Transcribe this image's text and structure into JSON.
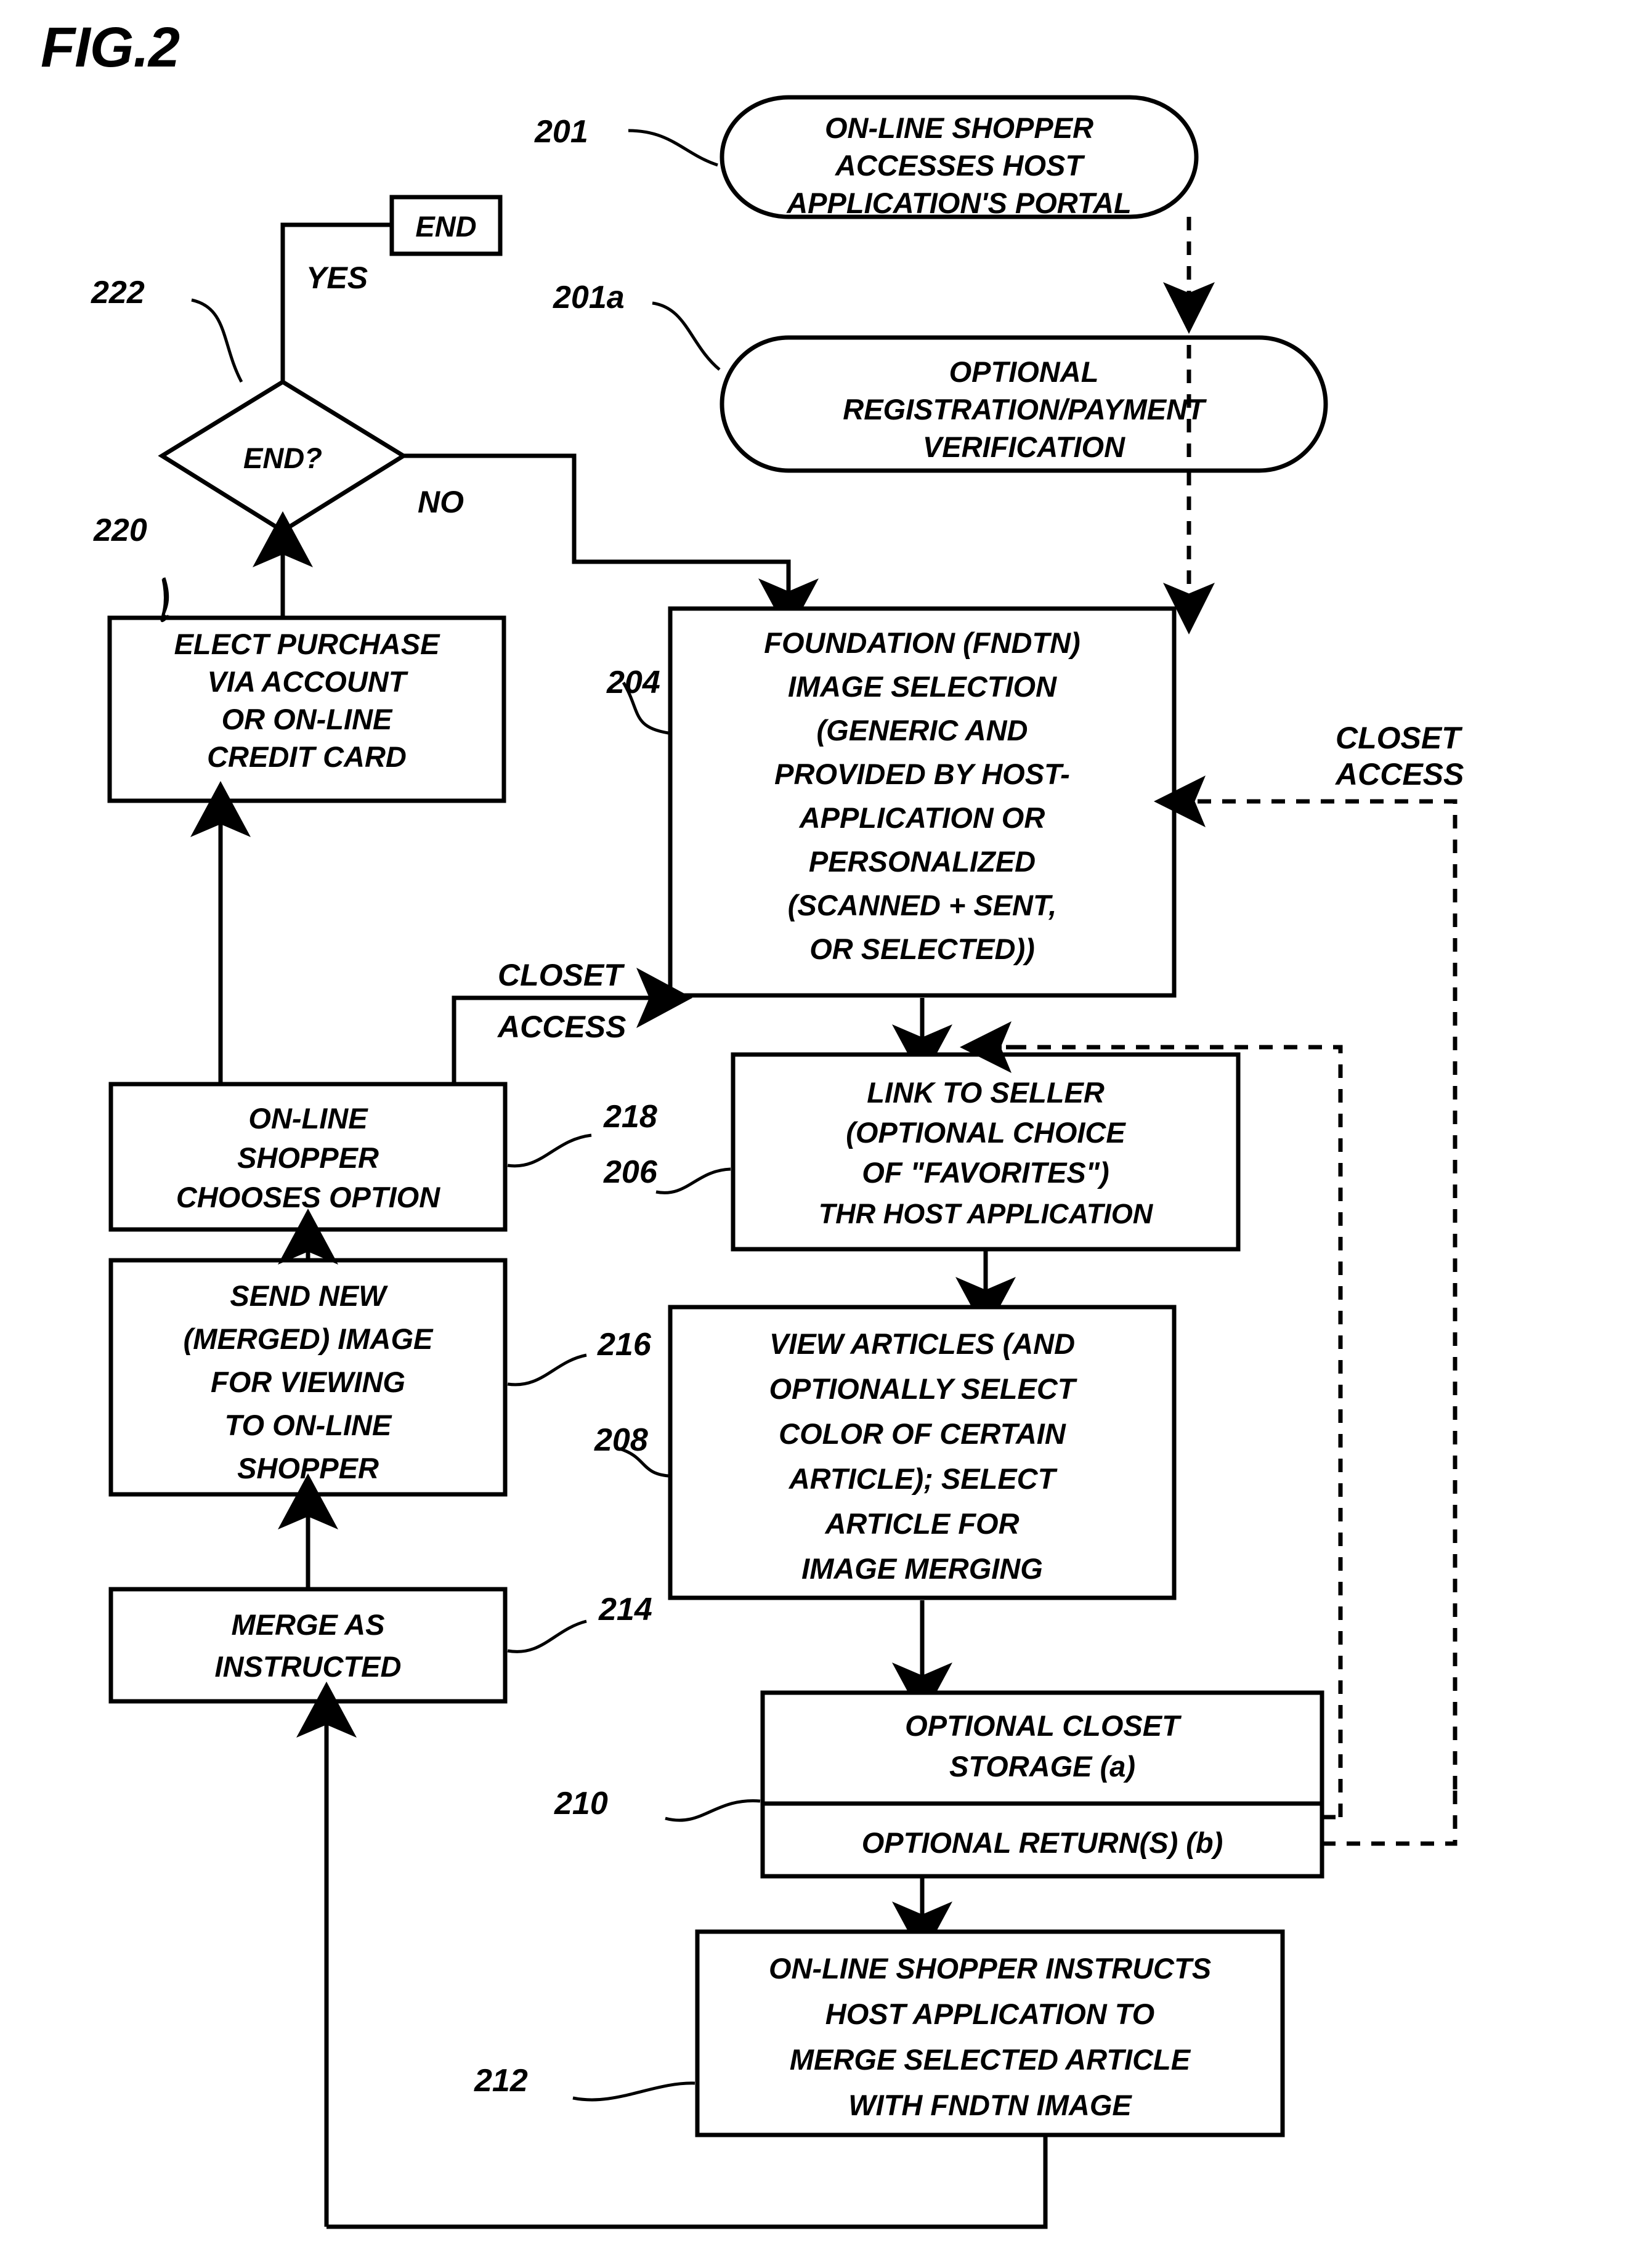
{
  "figure": {
    "title": "FIG.2",
    "domain_note": "patent flowchart"
  },
  "nodes": [
    {
      "id": "201",
      "ref": "201",
      "shape": "stadium",
      "lines": [
        "ON-LINE SHOPPER",
        "ACCESSES HOST",
        "APPLICATION'S PORTAL"
      ]
    },
    {
      "id": "201a",
      "ref": "201a",
      "shape": "stadium",
      "lines": [
        "OPTIONAL",
        "REGISTRATION/PAYMENT",
        "VERIFICATION"
      ]
    },
    {
      "id": "end_terminal",
      "ref": "",
      "shape": "rect",
      "lines": [
        "END"
      ]
    },
    {
      "id": "222",
      "ref": "222",
      "shape": "diamond",
      "lines": [
        "END?"
      ]
    },
    {
      "id": "220",
      "ref": "220",
      "shape": "rect",
      "lines": [
        "ELECT PURCHASE",
        "VIA ACCOUNT",
        "OR ON-LINE",
        "CREDIT CARD"
      ]
    },
    {
      "id": "204",
      "ref": "204",
      "shape": "rect",
      "lines": [
        "FOUNDATION (FNDTN)",
        "IMAGE SELECTION",
        "(GENERIC AND",
        "PROVIDED BY HOST-",
        "APPLICATION OR",
        "PERSONALIZED",
        "(SCANNED + SENT,",
        "OR SELECTED))"
      ]
    },
    {
      "id": "218",
      "ref": "218",
      "shape": "rect",
      "lines": [
        "ON-LINE",
        "SHOPPER",
        "CHOOSES OPTION"
      ]
    },
    {
      "id": "206",
      "ref": "206",
      "shape": "rect",
      "lines": [
        "LINK TO SELLER",
        "(OPTIONAL CHOICE",
        "OF \"FAVORITES\")",
        "THR HOST APPLICATION"
      ]
    },
    {
      "id": "216",
      "ref": "216",
      "shape": "rect",
      "lines": [
        "SEND NEW",
        "(MERGED) IMAGE",
        "FOR VIEWING",
        "TO ON-LINE",
        "SHOPPER"
      ]
    },
    {
      "id": "208",
      "ref": "208",
      "shape": "rect",
      "lines": [
        "VIEW ARTICLES (AND",
        "OPTIONALLY SELECT",
        "COLOR OF CERTAIN",
        "ARTICLE); SELECT",
        "ARTICLE FOR",
        "IMAGE MERGING"
      ]
    },
    {
      "id": "214",
      "ref": "214",
      "shape": "rect",
      "lines": [
        "MERGE AS",
        "INSTRUCTED"
      ]
    },
    {
      "id": "210",
      "ref": "210",
      "shape": "rect-split",
      "lines_top": [
        "OPTIONAL CLOSET",
        "STORAGE (a)"
      ],
      "lines_bottom": [
        "OPTIONAL RETURN(S) (b)"
      ]
    },
    {
      "id": "212",
      "ref": "212",
      "shape": "rect",
      "lines": [
        "ON-LINE SHOPPER INSTRUCTS",
        "HOST APPLICATION TO",
        "MERGE SELECTED ARTICLE",
        "WITH FNDTN IMAGE"
      ]
    }
  ],
  "edge_labels": {
    "yes": "YES",
    "no": "NO",
    "closet_access_left_line1": "CLOSET",
    "closet_access_left_line2": "ACCESS",
    "closet_access_right_line1": "CLOSET",
    "closet_access_right_line2": "ACCESS"
  },
  "ref_numbers": {
    "n201": "201",
    "n201a": "201a",
    "n222": "222",
    "n220": "220",
    "n204": "204",
    "n218": "218",
    "n206": "206",
    "n216": "216",
    "n208": "208",
    "n214": "214",
    "n210": "210",
    "n212": "212"
  },
  "colors": {
    "ink": "#000000",
    "paper": "#ffffff"
  }
}
